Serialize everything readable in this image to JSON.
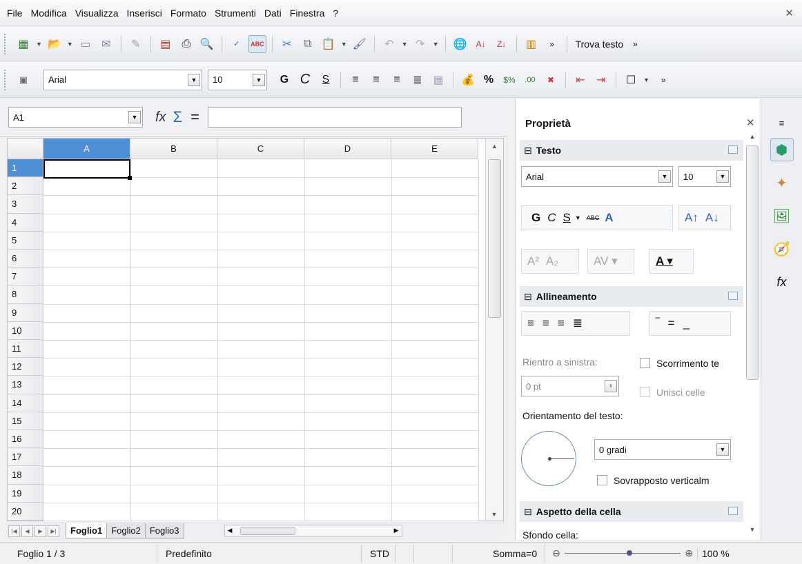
{
  "menu": {
    "items": [
      "File",
      "Modifica",
      "Visualizza",
      "Inserisci",
      "Formato",
      "Strumenti",
      "Dati",
      "Finestra",
      "?"
    ]
  },
  "toolbar1": {
    "find_label": "Trova testo"
  },
  "toolbar2": {
    "font_name": "Arial",
    "font_size": "10",
    "bold": "G",
    "italic": "C",
    "underline": "S"
  },
  "formula": {
    "cell_ref": "A1",
    "value": ""
  },
  "grid": {
    "columns": [
      "A",
      "B",
      "C",
      "D",
      "E"
    ],
    "rows": [
      "1",
      "2",
      "3",
      "4",
      "5",
      "6",
      "7",
      "8",
      "9",
      "10",
      "11",
      "12",
      "13",
      "14",
      "15",
      "16",
      "17",
      "18",
      "19",
      "20"
    ]
  },
  "sheets": {
    "tabs": [
      "Foglio1",
      "Foglio2",
      "Foglio3"
    ],
    "active": "Foglio1"
  },
  "status": {
    "sheet": "Foglio 1 / 3",
    "style": "Predefinito",
    "mode": "STD",
    "sum": "Somma=0",
    "zoom": "100 %"
  },
  "sidebar": {
    "title": "Proprietà",
    "text_section": "Testo",
    "font_name": "Arial",
    "font_size": "10",
    "align_section": "Allineamento",
    "indent_label": "Rientro a sinistra:",
    "indent_value": "0 pt",
    "wrap_label": "Scorrimento te",
    "merge_label": "Unisci celle",
    "orientation_label": "Orientamento del testo:",
    "degrees_value": "0 gradi",
    "stacked_label": "Sovrapposto verticalm",
    "cell_section": "Aspetto della cella",
    "bg_label": "Sfondo cella:"
  }
}
